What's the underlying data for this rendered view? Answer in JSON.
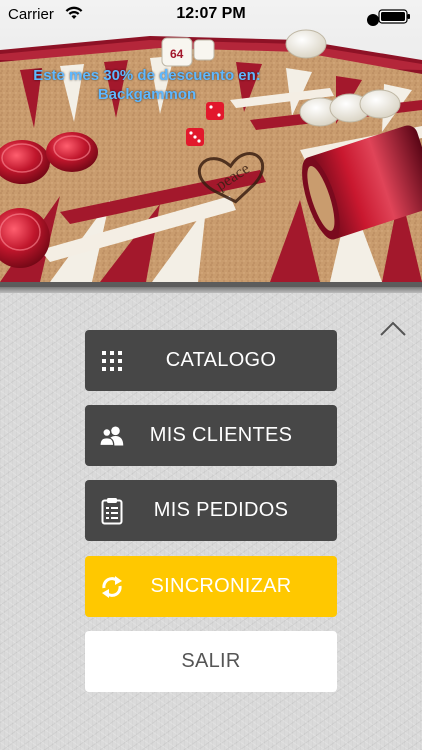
{
  "status_bar": {
    "carrier": "Carrier",
    "time": "12:07 PM"
  },
  "banner": {
    "promo_line1": "Este mes 30% de descuento en:",
    "promo_line2": "Backgammon",
    "brand_mark": "peace"
  },
  "menu": {
    "items": [
      {
        "label": "CATALOGO",
        "icon": "grid-icon",
        "style": "dark"
      },
      {
        "label": "MIS CLIENTES",
        "icon": "users-icon",
        "style": "dark"
      },
      {
        "label": "MIS PEDIDOS",
        "icon": "clipboard-icon",
        "style": "dark"
      },
      {
        "label": "SINCRONIZAR",
        "icon": "sync-icon",
        "style": "yellow"
      },
      {
        "label": "SALIR",
        "icon": "",
        "style": "white"
      }
    ]
  },
  "colors": {
    "dark_button": "#474747",
    "accent_yellow": "#ffc800",
    "promo_text": "#5fb8ff",
    "board_red": "#a3182c",
    "cork": "#c89a6c"
  }
}
